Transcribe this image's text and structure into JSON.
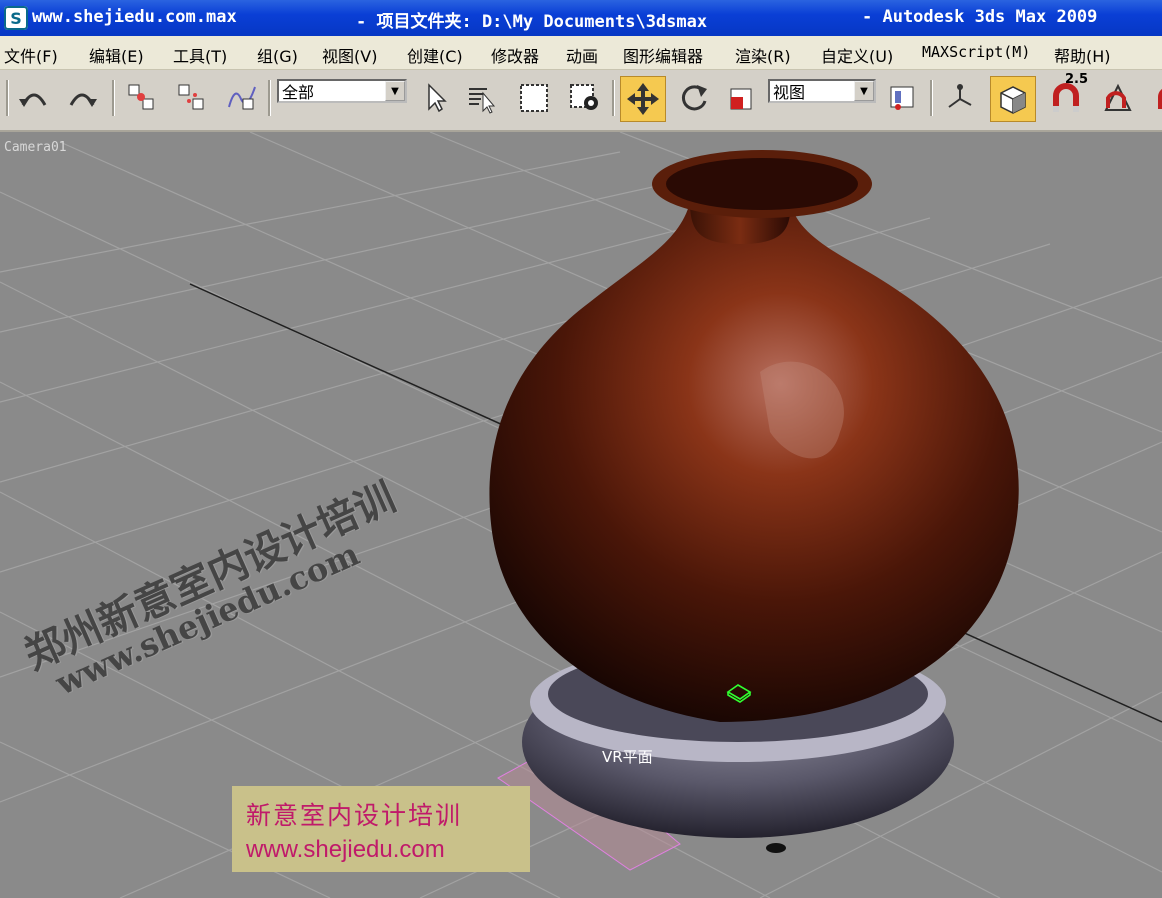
{
  "window": {
    "file_name": "www.shejiedu.com.max",
    "project_label": "- 项目文件夹: D:\\My Documents\\3dsmax",
    "app_name": "- Autodesk 3ds Max  2009"
  },
  "menu": {
    "items": [
      "文件(F)",
      "编辑(E)",
      "工具(T)",
      "组(G)",
      "视图(V)",
      "创建(C)",
      "修改器",
      "动画",
      "图形编辑器",
      "渲染(R)",
      "自定义(U)",
      "MAXScript(M)",
      "帮助(H)"
    ]
  },
  "toolbar": {
    "selection_filter": "全部",
    "reference_coord": "视图",
    "snap_value": "2.5"
  },
  "viewport": {
    "label": "Camera01",
    "object_label": "VR平面",
    "watermark_line1": "郑州新意室内设计培训",
    "watermark_line2": "www.shejiedu.com"
  },
  "caption": {
    "line1": "新意室内设计培训",
    "line2": "www.shejiedu.com"
  },
  "colors": {
    "title_bar": "#0a3fd6",
    "active_tool": "#f5c950",
    "viewport_bg": "#8a8a8a",
    "caption_text": "#c01a6a"
  }
}
